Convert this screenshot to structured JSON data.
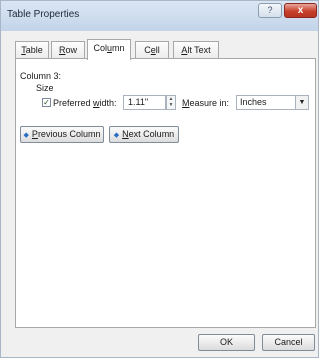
{
  "window": {
    "title": "Table Properties",
    "help_glyph": "?",
    "close_glyph": "x"
  },
  "tabs": [
    {
      "pre": "",
      "key": "T",
      "post": "able"
    },
    {
      "pre": "",
      "key": "R",
      "post": "ow"
    },
    {
      "pre": "Col",
      "key": "u",
      "post": "mn"
    },
    {
      "pre": "C",
      "key": "e",
      "post": "ll"
    },
    {
      "pre": "",
      "key": "A",
      "post": "lt Text"
    }
  ],
  "column": {
    "heading": "Column 3:",
    "size_label": "Size",
    "preferred_width_checked": true,
    "preferred_width_pre": "Preferred ",
    "preferred_width_key": "w",
    "preferred_width_post": "idth:",
    "width_value": "1.11\"",
    "measure_key": "M",
    "measure_post": "easure in:",
    "measure_value": "Inches"
  },
  "nav": {
    "previous_key": "P",
    "previous_post": "revious Column",
    "next_key": "N",
    "next_post": "ext Column"
  },
  "footer": {
    "ok_label": "OK",
    "cancel_label": "Cancel"
  }
}
